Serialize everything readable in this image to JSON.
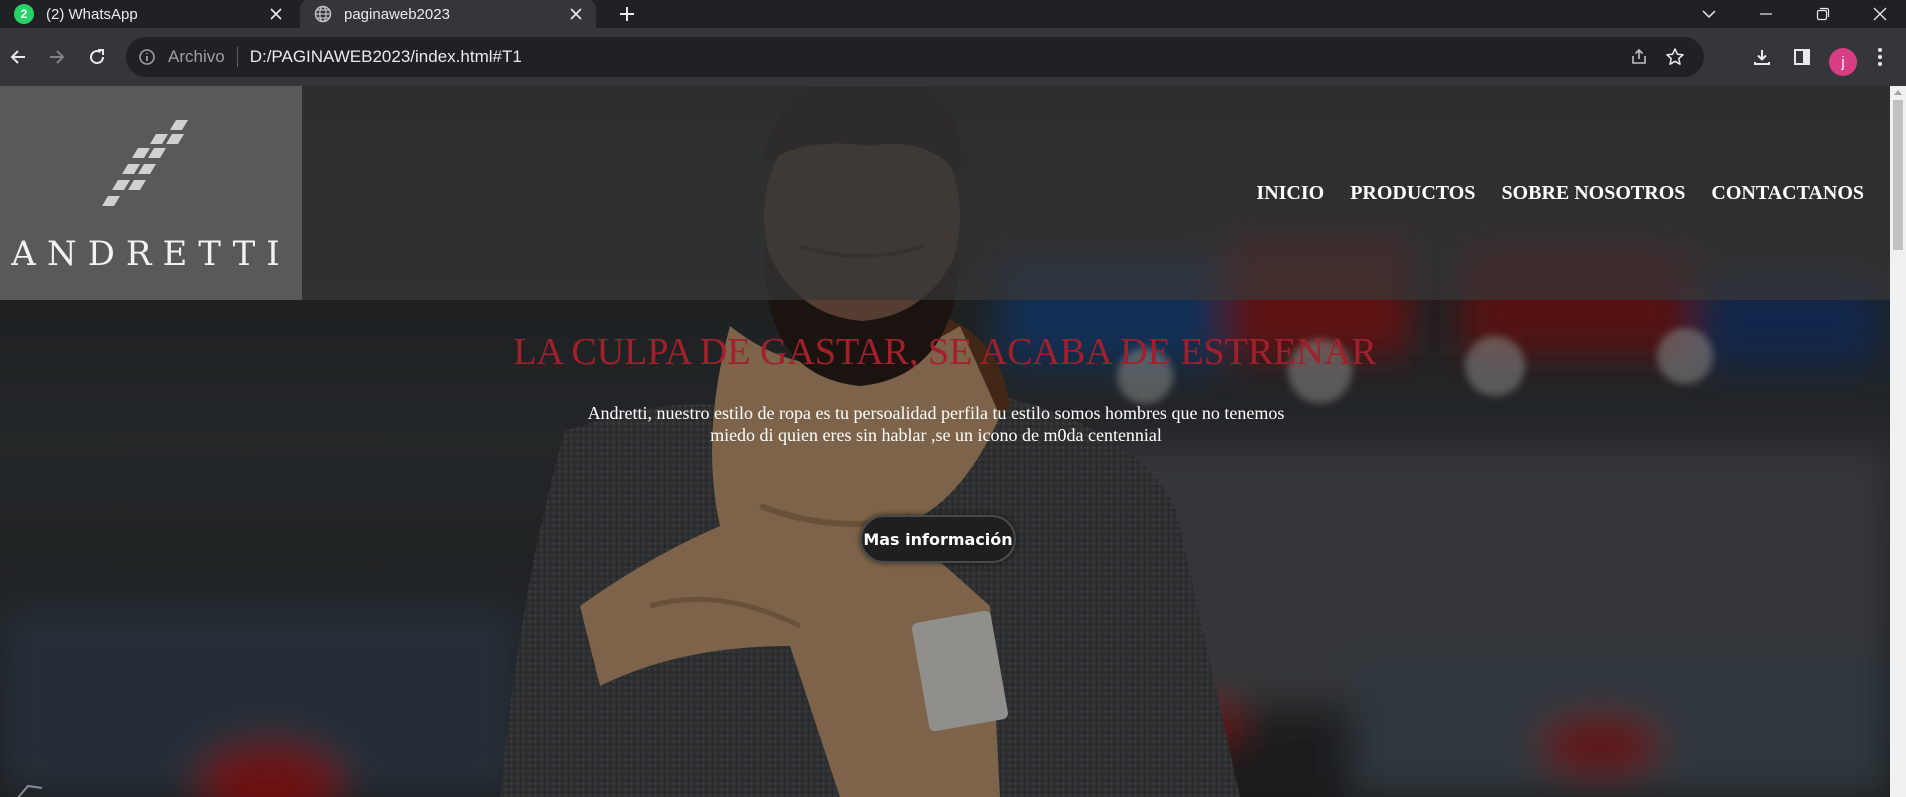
{
  "browser": {
    "tabs": [
      {
        "title": "(2) WhatsApp",
        "badge": "2"
      },
      {
        "title": "paginaweb2023"
      }
    ],
    "address": {
      "scheme": "Archivo",
      "url": "D:/PAGINAWEB2023/index.html#T1"
    },
    "profile_initial": "j"
  },
  "site": {
    "logo": "ANDRETTI",
    "nav": [
      "INICIO",
      "PRODUCTOS",
      "SOBRE NOSOTROS",
      "CONTACTANOS"
    ],
    "hero": {
      "title": "LA CULPA DE GASTAR, SE ACABA DE ESTRENAR",
      "text_line1": "Andretti, nuestro estilo de ropa es tu persoalidad perfila tu estilo somos hombres que no tenemos",
      "text_line2": "miedo di quien eres sin hablar ,se un icono de m0da centennial",
      "button": "Mas información"
    }
  },
  "colors": {
    "hero_title": "#a2202b",
    "whatsapp": "#25d366",
    "avatar": "#d93d83"
  },
  "icons": [
    "whatsapp-icon",
    "globe-icon",
    "close-icon",
    "plus-icon",
    "back-icon",
    "forward-icon",
    "reload-icon",
    "info-icon",
    "share-icon",
    "star-icon",
    "download-icon",
    "side-panel-icon",
    "menu-dots-icon"
  ]
}
